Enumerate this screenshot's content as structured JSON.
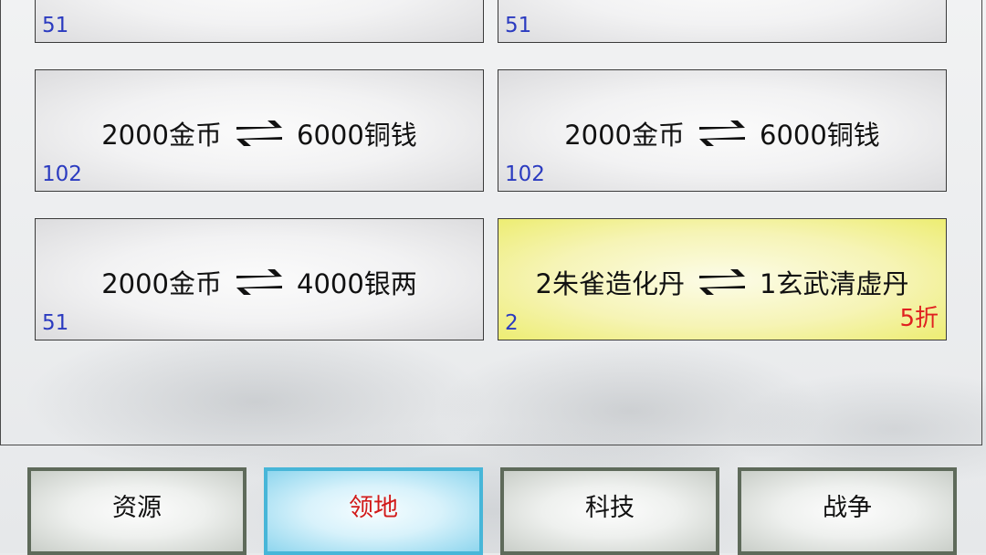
{
  "cards": [
    {
      "give": "",
      "get": "",
      "count": "51"
    },
    {
      "give": "",
      "get": "",
      "count": "51"
    },
    {
      "give": "2000金币",
      "get": "6000铜钱",
      "count": "102"
    },
    {
      "give": "2000金币",
      "get": "6000铜钱",
      "count": "102"
    },
    {
      "give": "2000金币",
      "get": "4000银两",
      "count": "51"
    },
    {
      "give": "2朱雀造化丹",
      "get": "1玄武清虚丹",
      "count": "2",
      "discount": "5折"
    }
  ],
  "tabs": [
    {
      "label": "资源"
    },
    {
      "label": "领地",
      "active": true
    },
    {
      "label": "科技"
    },
    {
      "label": "战争"
    }
  ],
  "colors": {
    "count_text": "#2b3bc0",
    "discount_text": "#e02020",
    "highlight_card": "#f6f4b6",
    "active_tab_border": "#47b6d8",
    "active_tab_text": "#d11a1a"
  },
  "icons": {
    "exchange": "exchange-arrows-icon"
  }
}
